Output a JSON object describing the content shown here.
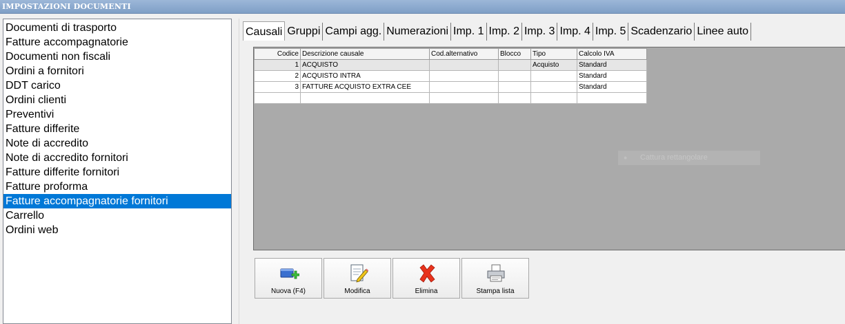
{
  "window": {
    "title": "IMPOSTAZIONI DOCUMENTI"
  },
  "sidebar": {
    "items": [
      {
        "label": "Documenti di trasporto"
      },
      {
        "label": "Fatture accompagnatorie"
      },
      {
        "label": "Documenti non fiscali"
      },
      {
        "label": "Ordini a fornitori"
      },
      {
        "label": "DDT carico"
      },
      {
        "label": "Ordini clienti"
      },
      {
        "label": "Preventivi"
      },
      {
        "label": "Fatture differite"
      },
      {
        "label": "Note di accredito"
      },
      {
        "label": "Note di accredito fornitori"
      },
      {
        "label": "Fatture differite fornitori"
      },
      {
        "label": "Fatture proforma"
      },
      {
        "label": "Fatture accompagnatorie fornitori",
        "selected": true
      },
      {
        "label": "Carrello"
      },
      {
        "label": "Ordini web"
      }
    ]
  },
  "tabs": [
    {
      "label": "Causali",
      "active": true
    },
    {
      "label": "Gruppi"
    },
    {
      "label": "Campi agg."
    },
    {
      "label": "Numerazioni"
    },
    {
      "label": "Imp. 1"
    },
    {
      "label": "Imp. 2"
    },
    {
      "label": "Imp. 3"
    },
    {
      "label": "Imp. 4"
    },
    {
      "label": "Imp. 5"
    },
    {
      "label": "Scadenzario"
    },
    {
      "label": "Linee auto"
    }
  ],
  "grid": {
    "columns": [
      "Codice",
      "Descrizione causale",
      "Cod.alternativo",
      "Blocco",
      "Tipo",
      "Calcolo IVA"
    ],
    "rows": [
      [
        "1",
        "ACQUISTO",
        "",
        "",
        "Acquisto",
        "Standard"
      ],
      [
        "2",
        "ACQUISTO INTRA",
        "",
        "",
        "",
        "Standard"
      ],
      [
        "3",
        "FATTURE ACQUISTO EXTRA CEE",
        "",
        "",
        "",
        "Standard"
      ],
      [
        "",
        "",
        "",
        "",
        "",
        ""
      ]
    ]
  },
  "watermark": {
    "text": "Cattura rettangolare",
    "icon": "record-dot-icon"
  },
  "toolbar": {
    "new_label": "Nuova (F4)",
    "edit_label": "Modifica",
    "delete_label": "Elimina",
    "print_label": "Stampa lista"
  },
  "colors": {
    "selection": "#0078d7",
    "titlebar": "#8faacf",
    "grid_background": "#aaaaaa",
    "delete_red": "#e8321c",
    "add_green": "#3cbf3c"
  }
}
